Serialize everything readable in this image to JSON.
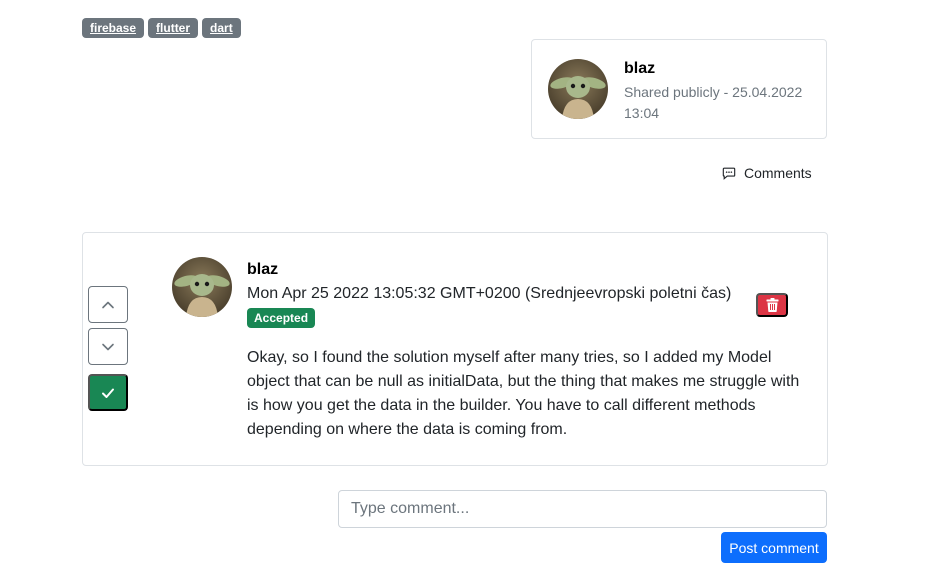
{
  "tags": [
    "firebase",
    "flutter",
    "dart"
  ],
  "question_author": {
    "name": "blaz",
    "meta": "Shared publicly - 25.04.2022 13:04"
  },
  "comments_link": {
    "label": "Comments",
    "icon": "comment-icon"
  },
  "answer": {
    "author": "blaz",
    "date": "Mon Apr 25 2022 13:05:32 GMT+0200 (Srednjeevropski poletni čas)",
    "badge": "Accepted",
    "body": "Okay, so I found the solution myself after many tries, so I added my Model object that can be null as initialData, but the thing that makes me struggle with is how you get the data in the builder. You have to call different methods depending on where the data is coming from.",
    "icons": {
      "up": "chevron-up-icon",
      "down": "chevron-down-icon",
      "accept": "check-icon",
      "delete": "trash-icon"
    }
  },
  "comment_form": {
    "placeholder": "Type comment...",
    "submit_label": "Post comment"
  },
  "colors": {
    "tag": "#6c757d",
    "success": "#198754",
    "danger": "#dc3545",
    "primary": "#0d6efd"
  }
}
